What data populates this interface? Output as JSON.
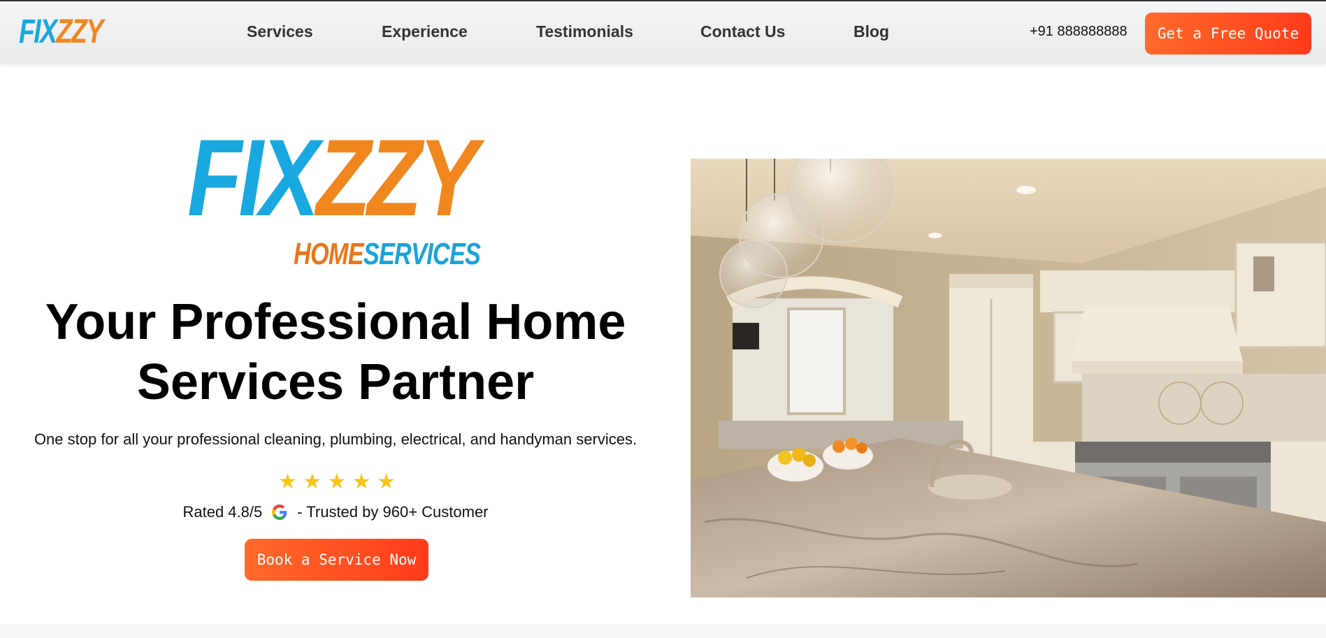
{
  "header": {
    "logo": {
      "part1": "FIX",
      "part2": "ZZY"
    },
    "nav": [
      {
        "label": "Services"
      },
      {
        "label": "Experience"
      },
      {
        "label": "Testimonials"
      },
      {
        "label": "Contact Us"
      },
      {
        "label": "Blog"
      }
    ],
    "phone": "+91 888888888",
    "cta_label": "Get a Free Quote"
  },
  "hero": {
    "logo": {
      "part1": "FIX",
      "part2": "ZZY",
      "sub1": "HOME",
      "sub2": "SERVICES"
    },
    "headline_line1": "Your Professional Home",
    "headline_line2": "Services Partner",
    "subtitle": "One stop for all your professional cleaning, plumbing, electrical, and handyman services.",
    "stars": [
      "★",
      "★",
      "★",
      "★",
      "★"
    ],
    "rating_text": "Rated 4.8/5",
    "trust_text": "- Trusted by 960+ Customer",
    "cta_label": "Book a Service Now",
    "image_alt": "kitchen-photo"
  },
  "colors": {
    "brand_blue": "#19a8e0",
    "brand_orange": "#f0861e",
    "cta_gradient_start": "#ff6a2a",
    "cta_gradient_end": "#ff3b1a",
    "star": "#f5c518"
  }
}
